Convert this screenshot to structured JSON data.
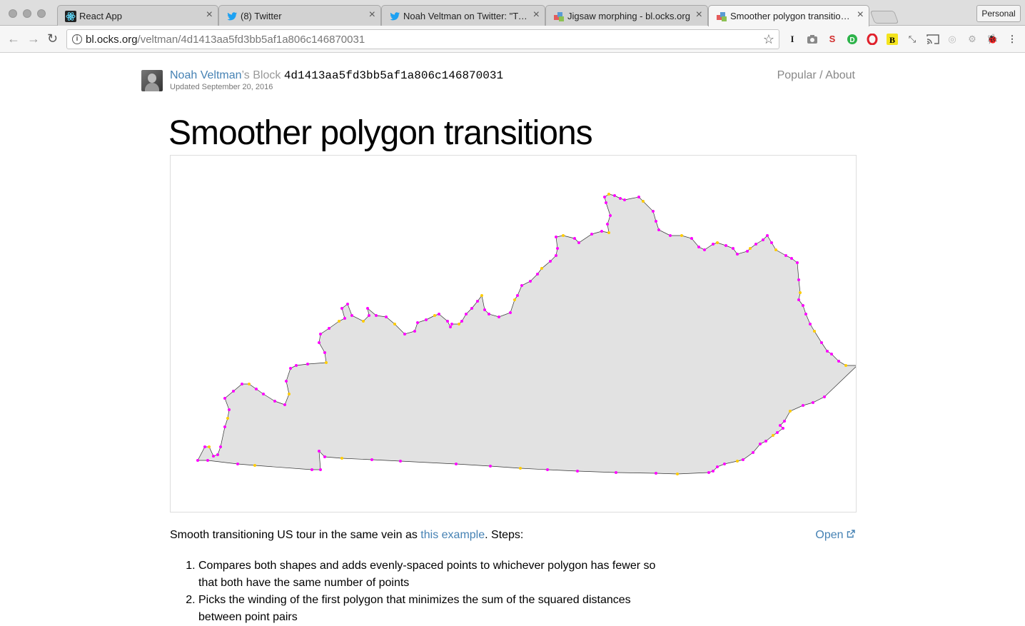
{
  "browser": {
    "tabs": [
      {
        "title": "React App",
        "icon": "react-icon"
      },
      {
        "title": "(8) Twitter",
        "icon": "twitter-icon"
      },
      {
        "title": "Noah Veltman on Twitter: \"Turn",
        "icon": "twitter-icon"
      },
      {
        "title": "Jigsaw morphing - bl.ocks.org",
        "icon": "blocks-icon"
      },
      {
        "title": "Smoother polygon transitions -",
        "icon": "blocks-icon"
      }
    ],
    "active_tab": 4,
    "profile": "Personal",
    "url_host": "bl.ocks.org",
    "url_path": "/veltman/4d1413aa5fd3bb5af1a806c146870031"
  },
  "block": {
    "author": "Noah Veltman",
    "suffix": "’s Block",
    "hash": "4d1413aa5fd3bb5af1a806c146870031",
    "updated": "Updated September 20, 2016",
    "nav_popular": "Popular",
    "nav_separator": " / ",
    "nav_about": "About"
  },
  "title": "Smoother polygon transitions",
  "description": {
    "before": "Smooth transitioning US tour in the same vein as ",
    "link": "this example",
    "after": ". Steps:",
    "open": "Open"
  },
  "steps": [
    "Compares both shapes and adds evenly-spaced points to whichever polygon has fewer so that both have the same number of points",
    "Picks the winding of the first polygon that minimizes the sum of the squared distances between point pairs"
  ],
  "visualization": {
    "fill": "#e2e2e2",
    "stroke": "#333333",
    "original_point_color": "#ff00ff",
    "added_point_color": "#ffcc00"
  }
}
